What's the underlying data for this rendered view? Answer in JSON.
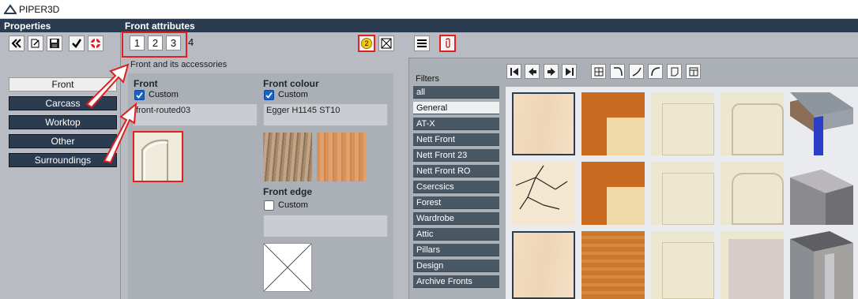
{
  "app": {
    "title": "PIPER3D"
  },
  "header": {
    "properties": "Properties",
    "front_attributes": "Front attributes"
  },
  "toolbar": {
    "tabs": [
      "1",
      "2",
      "3",
      "4"
    ],
    "badge": "2"
  },
  "left_nav": [
    {
      "label": "Front",
      "selected": true
    },
    {
      "label": "Carcass"
    },
    {
      "label": "Worktop"
    },
    {
      "label": "Other"
    },
    {
      "label": "Surroundings"
    }
  ],
  "front": {
    "section": "Front and its accessories",
    "front_label": "Front",
    "custom_label": "Custom",
    "front_value": "front-routed03",
    "colour_label": "Front colour",
    "colour_custom": "Custom",
    "colour_value": "Egger H1145 ST10",
    "edge_label": "Front edge",
    "edge_custom": "Custom",
    "front_custom_checked": true,
    "colour_custom_checked": true,
    "edge_custom_checked": false
  },
  "filters": {
    "title": "Filters",
    "items": [
      "all",
      "General",
      "AT-X",
      "Nett Front",
      "Nett Front 23",
      "Nett Front RO",
      "Csercsics",
      "Forest",
      "Wardrobe",
      "Attic",
      "Pillars",
      "Design",
      "Archive Fronts"
    ],
    "selected": "General"
  },
  "colors": {
    "header": "#2b3c50",
    "highlight": "#e0201f",
    "badge": "#f5c518"
  }
}
